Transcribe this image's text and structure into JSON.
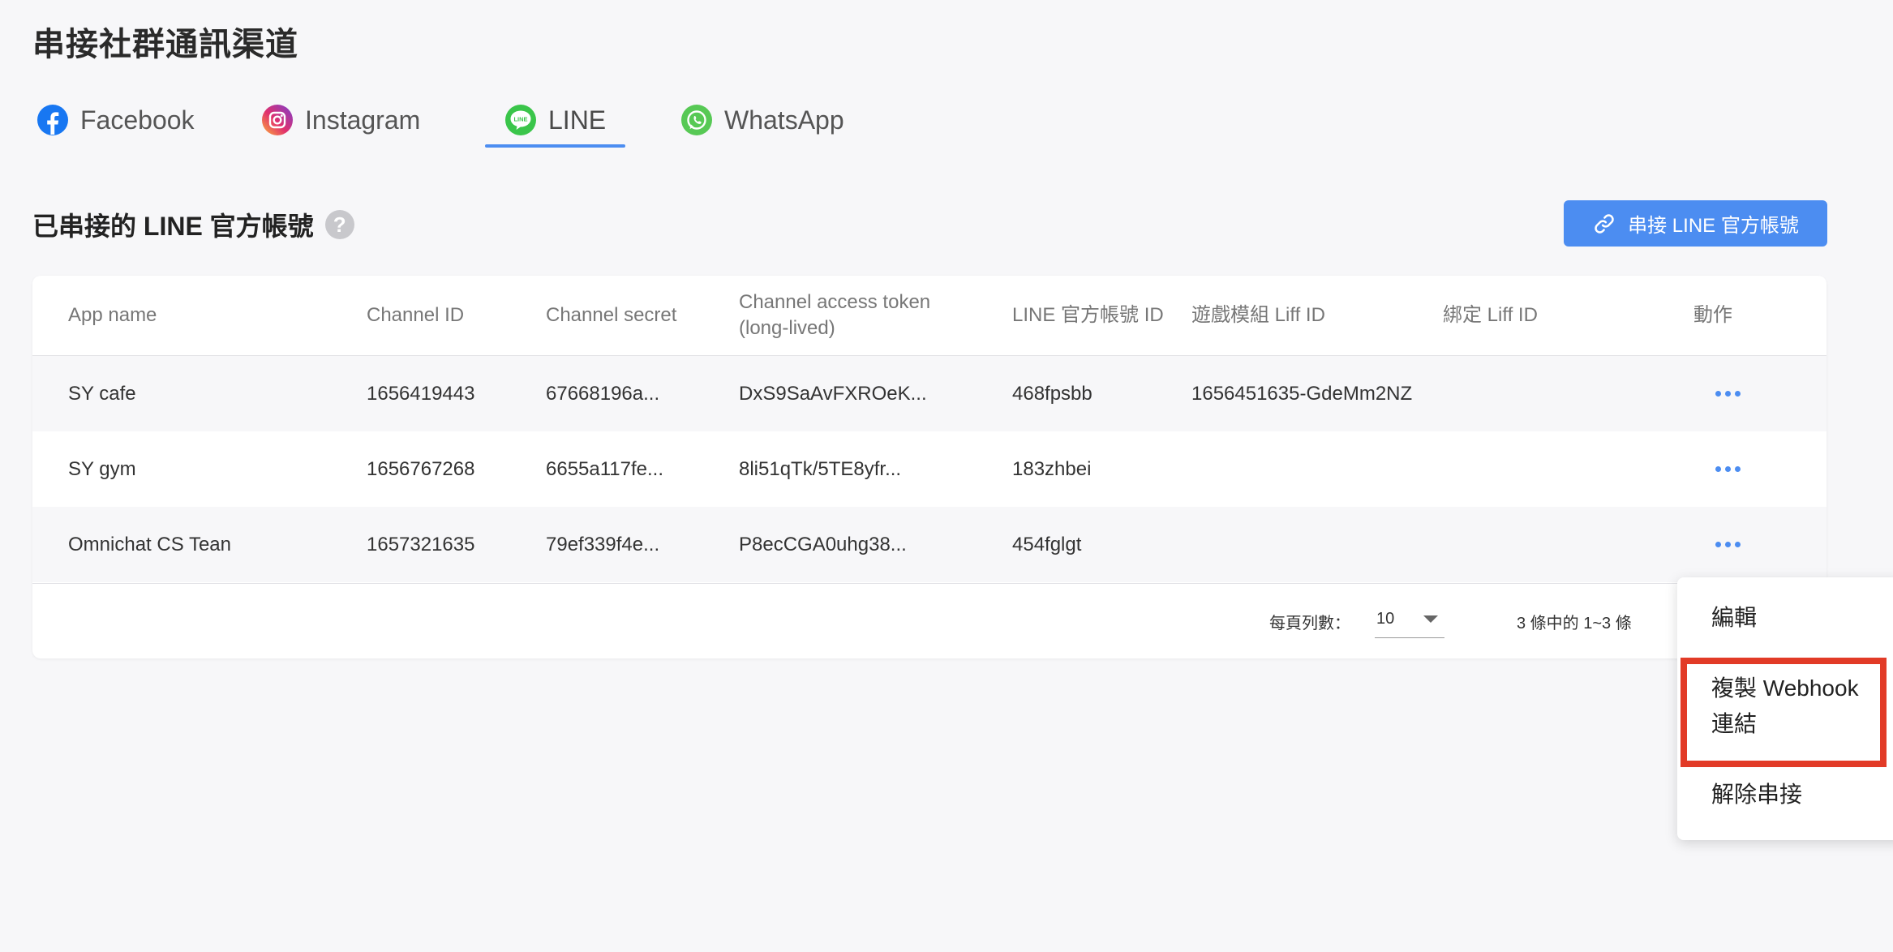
{
  "page": {
    "title": "串接社群通訊渠道"
  },
  "tabs": [
    {
      "label": "Facebook",
      "icon": "facebook-icon"
    },
    {
      "label": "Instagram",
      "icon": "instagram-icon"
    },
    {
      "label": "LINE",
      "icon": "line-icon",
      "active": true
    },
    {
      "label": "WhatsApp",
      "icon": "whatsapp-icon"
    }
  ],
  "section": {
    "title": "已串接的 LINE 官方帳號",
    "help_icon": "?"
  },
  "connect_button": {
    "label": "串接 LINE 官方帳號",
    "icon": "link-icon"
  },
  "table": {
    "columns": [
      "App name",
      "Channel ID",
      "Channel secret",
      "Channel access token\n(long-lived)",
      "LINE 官方帳號 ID",
      "遊戲模組 Liff ID",
      "綁定 Liff ID",
      "動作"
    ],
    "rows": [
      {
        "app_name": "SY cafe",
        "channel_id": "1656419443",
        "channel_secret": "67668196a...",
        "access_token": "DxS9SaAvFXROeK...",
        "official_id": "468fpsbb",
        "game_liff_id": "1656451635-GdeMm2NZ",
        "bind_liff_id": ""
      },
      {
        "app_name": "SY gym",
        "channel_id": "1656767268",
        "channel_secret": "6655a117fe...",
        "access_token": "8li51qTk/5TE8yfr...",
        "official_id": "183zhbei",
        "game_liff_id": "",
        "bind_liff_id": ""
      },
      {
        "app_name": "Omnichat CS Tean",
        "channel_id": "1657321635",
        "channel_secret": "79ef339f4e...",
        "access_token": "P8ecCGA0uhg38...",
        "official_id": "454fglgt",
        "game_liff_id": "",
        "bind_liff_id": ""
      }
    ]
  },
  "pagination": {
    "rows_per_page_label": "每頁列數：",
    "rows_per_page": "10",
    "range": "3 條中的 1~3 條"
  },
  "context_menu": {
    "items": [
      "編輯",
      "複製 Webhook\n連結",
      "解除串接"
    ],
    "highlight_color": "#e23b27"
  },
  "colors": {
    "accent": "#4c8df1",
    "background": "#f7f7f9"
  }
}
